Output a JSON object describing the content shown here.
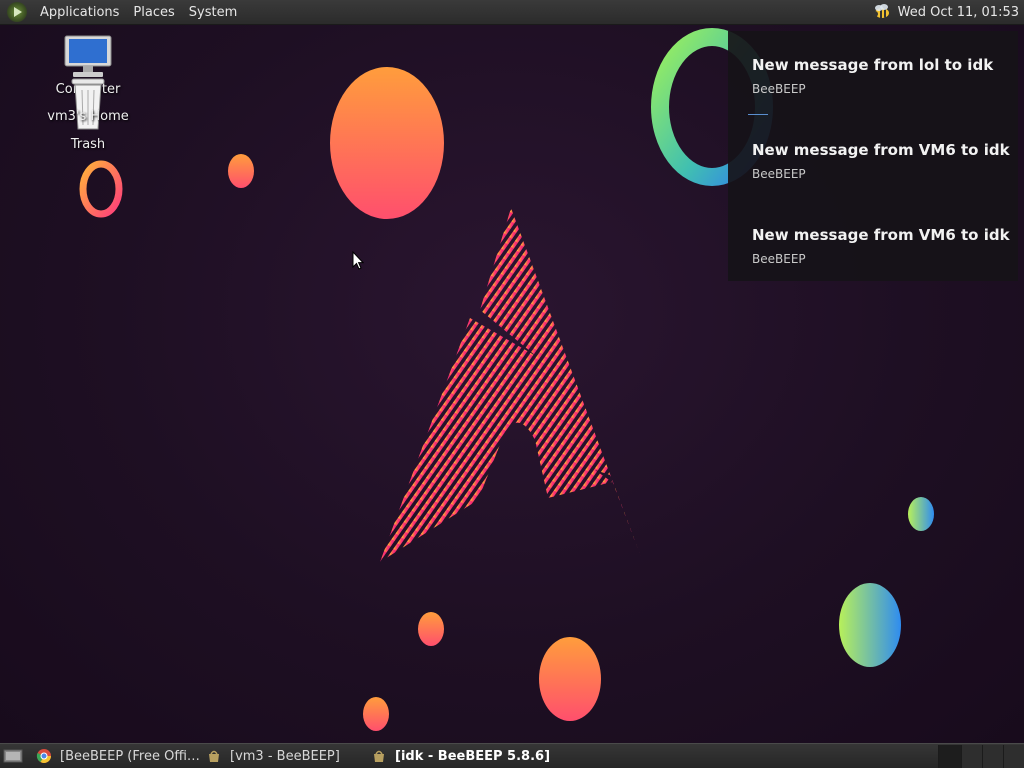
{
  "top_panel": {
    "menus": [
      "Applications",
      "Places",
      "System"
    ],
    "clock": "Wed Oct 11, 01:53"
  },
  "desktop_icons": {
    "computer": "Computer",
    "home": "vm3's Home",
    "trash": "Trash"
  },
  "notifications": [
    {
      "title": "New message from lol to idk",
      "app": "BeeBEEP"
    },
    {
      "title": "New message from VM6 to idk",
      "app": "BeeBEEP"
    },
    {
      "title": "New message from VM6 to idk",
      "app": "BeeBEEP"
    }
  ],
  "taskbar": {
    "tasks": [
      {
        "label": "[BeeBEEP (Free Offi…",
        "icon": "chrome-icon"
      },
      {
        "label": "[vm3 - BeeBEEP]",
        "icon": "beebeep-icon"
      },
      {
        "label": "[idk - BeeBEEP 5.8.6]",
        "icon": "beebeep-icon",
        "active": true
      }
    ],
    "workspace_count": 4
  },
  "colors": {
    "panel_bg": "#2b2b2b",
    "wallpaper_bg": "#1e0f23",
    "notification_bg": "#161218",
    "accent_blue": "#5a8fd0"
  }
}
